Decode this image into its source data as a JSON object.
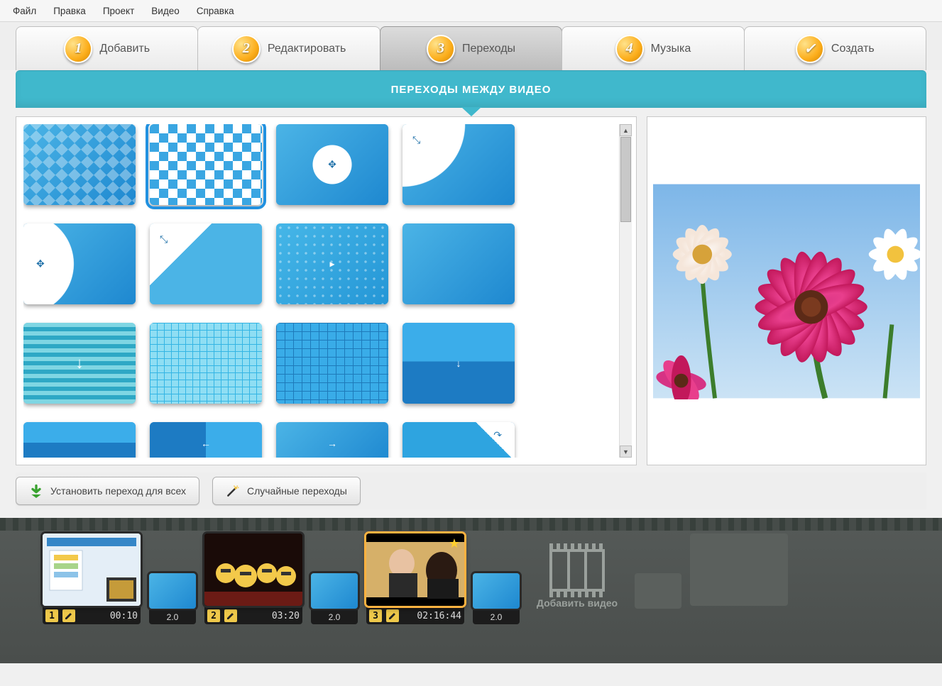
{
  "menu": {
    "file": "Файл",
    "edit": "Правка",
    "project": "Проект",
    "video": "Видео",
    "help": "Справка"
  },
  "steps": {
    "add": {
      "num": "1",
      "label": "Добавить"
    },
    "editstep": {
      "num": "2",
      "label": "Редактировать"
    },
    "transitions": {
      "num": "3",
      "label": "Переходы"
    },
    "music": {
      "num": "4",
      "label": "Музыка"
    },
    "create": {
      "num": "✓",
      "label": "Создать"
    }
  },
  "header_title": "ПЕРЕХОДЫ МЕЖДУ ВИДЕО",
  "buttons": {
    "apply_all": "Установить переход для всех",
    "random": "Случайные переходы"
  },
  "timeline": {
    "clips": [
      {
        "num": "1",
        "time": "00:10"
      },
      {
        "num": "2",
        "time": "03:20"
      },
      {
        "num": "3",
        "time": "02:16:44"
      }
    ],
    "transition_duration": "2.0",
    "add_video_label": "Добавить видео"
  }
}
